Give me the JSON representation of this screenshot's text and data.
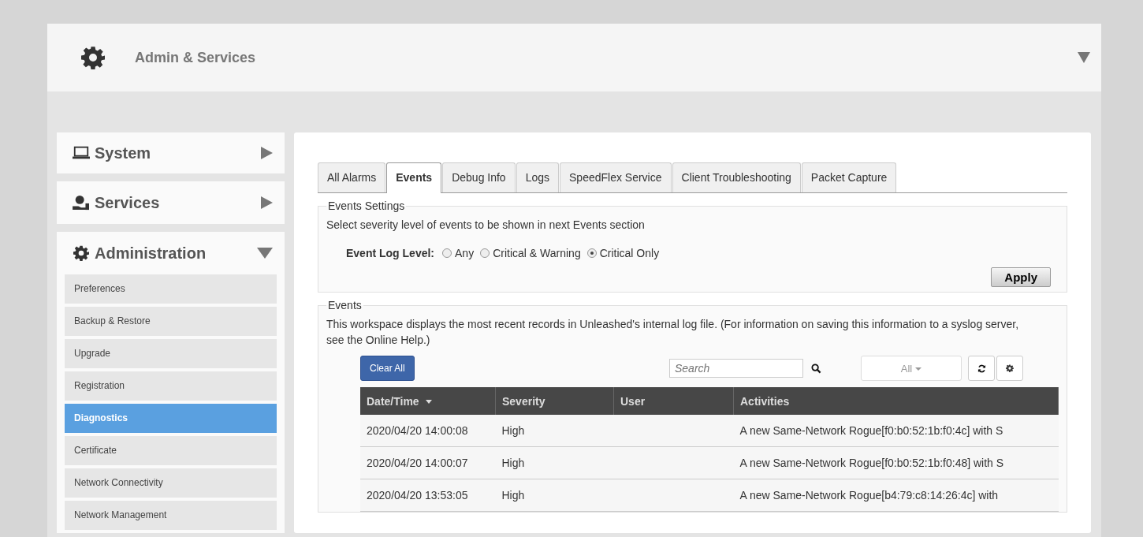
{
  "header": {
    "title": "Admin & Services"
  },
  "sidebar": {
    "sections": [
      {
        "kind": "system",
        "label": "System",
        "expanded": false
      },
      {
        "kind": "services",
        "label": "Services",
        "expanded": false
      },
      {
        "kind": "admin",
        "label": "Administration",
        "expanded": true,
        "items": [
          {
            "label": "Preferences",
            "selected": false
          },
          {
            "label": "Backup & Restore",
            "selected": false
          },
          {
            "label": "Upgrade",
            "selected": false
          },
          {
            "label": "Registration",
            "selected": false
          },
          {
            "label": "Diagnostics",
            "selected": true
          },
          {
            "label": "Certificate",
            "selected": false
          },
          {
            "label": "Network Connectivity",
            "selected": false
          },
          {
            "label": "Network Management",
            "selected": false
          }
        ]
      }
    ]
  },
  "tabs": [
    {
      "label": "All Alarms",
      "selected": false
    },
    {
      "label": "Events",
      "selected": true
    },
    {
      "label": "Debug Info",
      "selected": false
    },
    {
      "label": "Logs",
      "selected": false
    },
    {
      "label": "SpeedFlex Service",
      "selected": false
    },
    {
      "label": "Client Troubleshooting",
      "selected": false
    },
    {
      "label": "Packet Capture",
      "selected": false
    }
  ],
  "events_settings": {
    "legend": "Events Settings",
    "description": "Select severity level of events to be shown in next Events section",
    "level_label": "Event Log Level:",
    "options": [
      {
        "label": "Any",
        "selected": false
      },
      {
        "label": "Critical & Warning",
        "selected": false
      },
      {
        "label": "Critical Only",
        "selected": true
      }
    ],
    "apply": "Apply"
  },
  "events": {
    "legend": "Events",
    "description": "This workspace displays the most recent records in Unleashed's internal log file. (For information on saving this information to a syslog server, see the Online Help.)",
    "clear_button": "Clear All",
    "search": {
      "placeholder": "Search"
    },
    "filter": "All",
    "table": {
      "columns": [
        "Date/Time",
        "Severity",
        "User",
        "Activities"
      ],
      "rows": [
        [
          "2020/04/20  14:00:08",
          "High",
          "",
          "A new Same-Network Rogue[f0:b0:52:1b:f0:4c] with S"
        ],
        [
          "2020/04/20  14:00:07",
          "High",
          "",
          "A new Same-Network Rogue[f0:b0:52:1b:f0:48] with S"
        ],
        [
          "2020/04/20  13:53:05",
          "High",
          "",
          "A new Same-Network Rogue[b4:79:c8:14:26:4c] with"
        ]
      ]
    }
  }
}
